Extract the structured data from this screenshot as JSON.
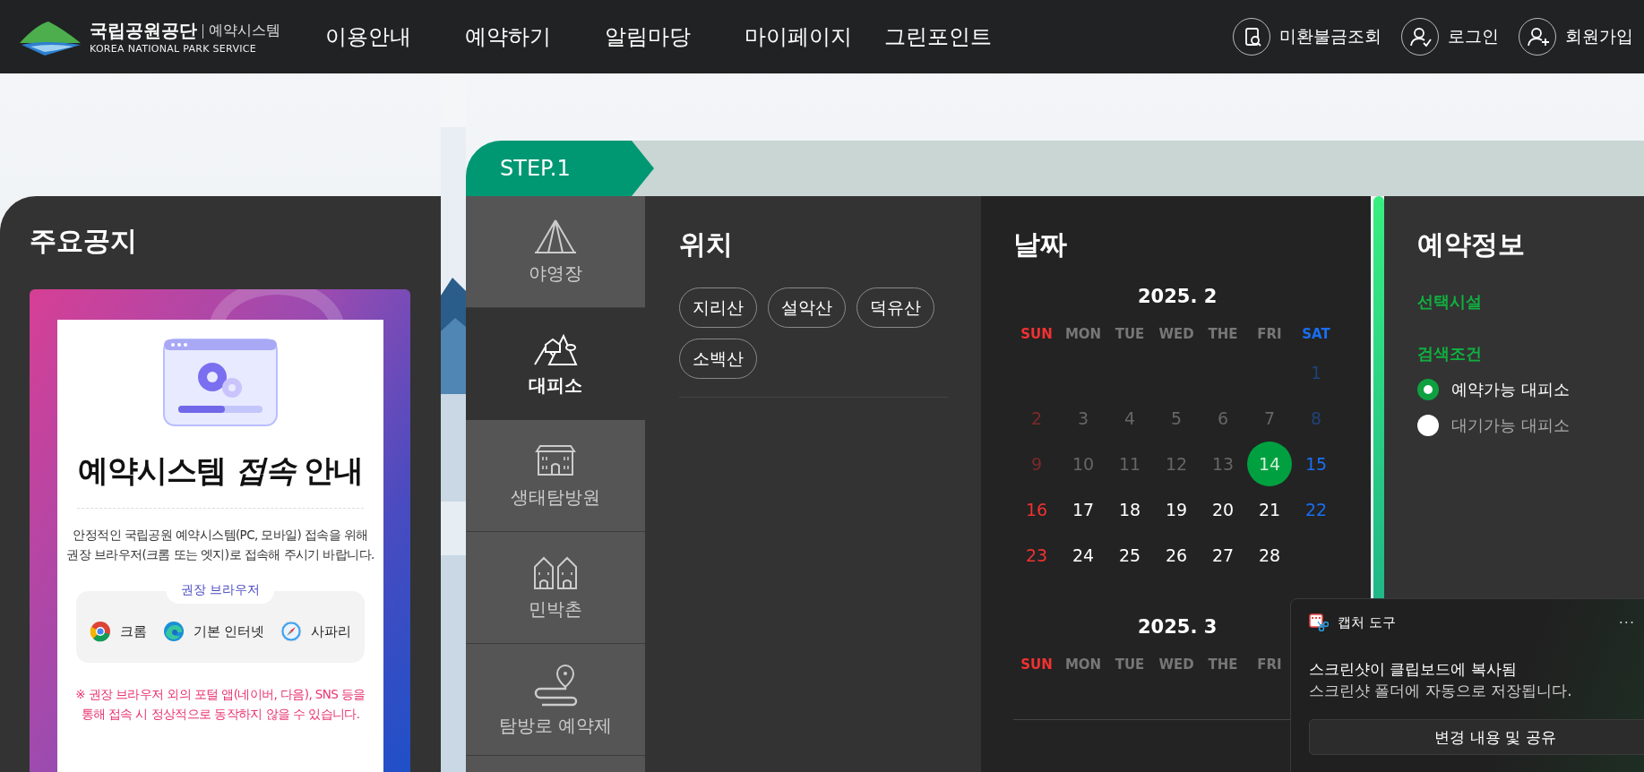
{
  "header": {
    "logo": {
      "name": "국립공원공단",
      "system": "예약시스템",
      "english": "KOREA NATIONAL PARK SERVICE"
    },
    "nav": [
      "이용안내",
      "예약하기",
      "알림마당",
      "마이페이지",
      "그린포인트"
    ],
    "actions": [
      {
        "label": "미환불금조회",
        "kind": "search"
      },
      {
        "label": "로그인",
        "kind": "login"
      },
      {
        "label": "회원가입",
        "kind": "signup"
      }
    ]
  },
  "notice": {
    "title": "주요공지",
    "card": {
      "title": "예약시스템 *접속* 안내",
      "body": [
        "안정적인 국립공원 예약시스템(PC, 모바일) 접속을 위해",
        "권장 브라우저(크롬 또는 엣지)로 접속해 주시기 바랍니다."
      ],
      "browsers_label": "권장 브라우저",
      "browsers": [
        {
          "name": "크롬",
          "kind": "chrome"
        },
        {
          "name": "기본 인터넷",
          "kind": "edge"
        },
        {
          "name": "사파리",
          "kind": "safari"
        }
      ],
      "warning": [
        "※ 권장 브라우저 외의 포털 앱(네이버, 다음), SNS 등을",
        "통해 접속 시 정상적으로 동작하지 않을 수 있습니다."
      ]
    }
  },
  "step": {
    "label": "STEP.1"
  },
  "facilities": [
    {
      "label": "야영장",
      "kind": "tent",
      "selected": false
    },
    {
      "label": "대피소",
      "kind": "shelter",
      "selected": true
    },
    {
      "label": "생태탐방원",
      "kind": "lodge",
      "selected": false
    },
    {
      "label": "민박촌",
      "kind": "village",
      "selected": false
    },
    {
      "label": "탐방로 예약제",
      "kind": "trail",
      "selected": false
    }
  ],
  "location": {
    "title": "위치",
    "options": [
      "지리산",
      "설악산",
      "덕유산",
      "소백산"
    ]
  },
  "calendar": {
    "title": "날짜",
    "months": [
      {
        "title": "2025. 2",
        "weekdays": [
          "SUN",
          "MON",
          "TUE",
          "WED",
          "THE",
          "FRI",
          "SAT"
        ],
        "weeks": [
          [
            {
              "label": "1",
              "past": true,
              "selected": false
            }
          ],
          [
            {
              "label": "2",
              "past": true,
              "selected": false
            },
            {
              "label": "3",
              "past": true,
              "selected": false
            },
            {
              "label": "4",
              "past": true,
              "selected": false
            },
            {
              "label": "5",
              "past": true,
              "selected": false
            },
            {
              "label": "6",
              "past": true,
              "selected": false
            },
            {
              "label": "7",
              "past": true,
              "selected": false
            },
            {
              "label": "8",
              "past": true,
              "selected": false
            }
          ],
          [
            {
              "label": "9",
              "past": true,
              "selected": false
            },
            {
              "label": "10",
              "past": true,
              "selected": false
            },
            {
              "label": "11",
              "past": true,
              "selected": false
            },
            {
              "label": "12",
              "past": true,
              "selected": false
            },
            {
              "label": "13",
              "past": true,
              "selected": false
            },
            {
              "label": "14",
              "past": true,
              "selected": true
            },
            {
              "label": "15",
              "past": false,
              "selected": false
            }
          ],
          [
            {
              "label": "16",
              "past": false,
              "selected": false
            },
            {
              "label": "17",
              "past": false,
              "selected": false
            },
            {
              "label": "18",
              "past": false,
              "selected": false
            },
            {
              "label": "19",
              "past": false,
              "selected": false
            },
            {
              "label": "20",
              "past": false,
              "selected": false
            },
            {
              "label": "21",
              "past": false,
              "selected": false
            },
            {
              "label": "22",
              "past": false,
              "selected": false
            }
          ],
          [
            {
              "label": "23",
              "past": false,
              "selected": false
            },
            {
              "label": "24",
              "past": false,
              "selected": false
            },
            {
              "label": "25",
              "past": false,
              "selected": false
            },
            {
              "label": "26",
              "past": false,
              "selected": false
            },
            {
              "label": "27",
              "past": false,
              "selected": false
            },
            {
              "label": "28",
              "past": false,
              "selected": false
            }
          ]
        ]
      },
      {
        "title": "2025. 3",
        "weekdays": [
          "SUN",
          "MON",
          "TUE",
          "WED",
          "THE",
          "FRI"
        ]
      }
    ]
  },
  "info": {
    "title": "예약정보",
    "facility_label": "선택시설",
    "condition_label": "검색조건",
    "conditions": [
      {
        "label": "예약가능 대피소",
        "selected": true
      },
      {
        "label": "대기가능 대피소",
        "selected": false
      }
    ]
  },
  "toast": {
    "app": "캡처 도구",
    "menu": "···",
    "message": "스크린샷이 클립보드에 복사됨",
    "detail": "스크린샷 폴더에 자동으로 저장됩니다.",
    "button": "변경 내용 및 공유"
  }
}
